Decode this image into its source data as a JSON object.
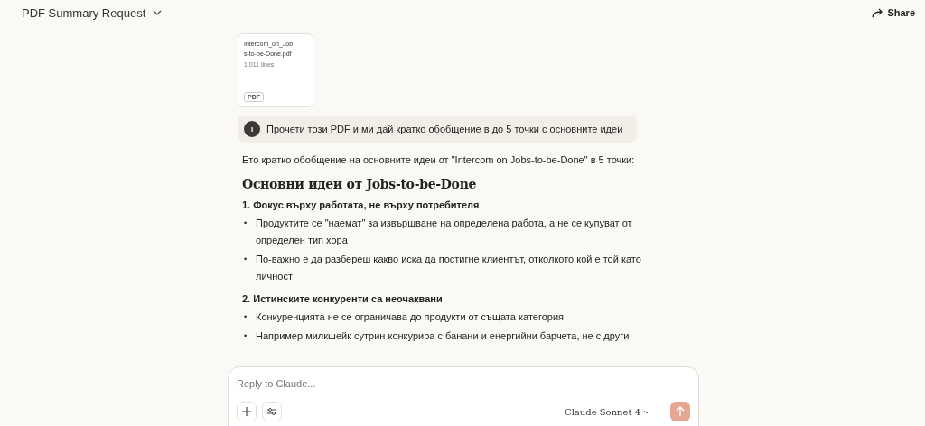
{
  "header": {
    "title": "PDF Summary Request",
    "share": "Share"
  },
  "attachment": {
    "name": "Intercom_on_Jobs-to-be-Done.pdf",
    "lines": "1,011 lines",
    "type": "PDF"
  },
  "user_message": {
    "avatar": "I",
    "text": "Прочети този PDF и ми дай кратко обобщение в до 5 точки с основните идеи"
  },
  "reply": {
    "intro": "Ето кратко обобщение на основните идеи от \"Intercom on Jobs-to-be-Done\" в 5 точки:",
    "heading": "Основни идеи от Jobs-to-be-Done",
    "sections": [
      {
        "title": "1. Фокус върху работата, не върху потребителя",
        "bullets": [
          {
            "marker": "•",
            "text": "Продуктите се \"наемат\" за извършване на определена работа, а не се купуват от определен тип хора"
          },
          {
            "marker": "•",
            "text": "По-важно е да разбереш какво иска да постигне клиентът, отколкото кой е той като личност"
          }
        ]
      },
      {
        "title": "2. Истинските конкуренти са неочаквани",
        "bullets": [
          {
            "marker": "•",
            "text": "Конкуренцията не се ограничава до продукти от същата категория"
          },
          {
            "marker": "•",
            "text": "Например милкшейк сутрин конкурира с банани и енергийни барчета, не с други"
          }
        ]
      }
    ]
  },
  "composer": {
    "placeholder": "Reply to Claude...",
    "model": "Claude Sonnet 4"
  }
}
